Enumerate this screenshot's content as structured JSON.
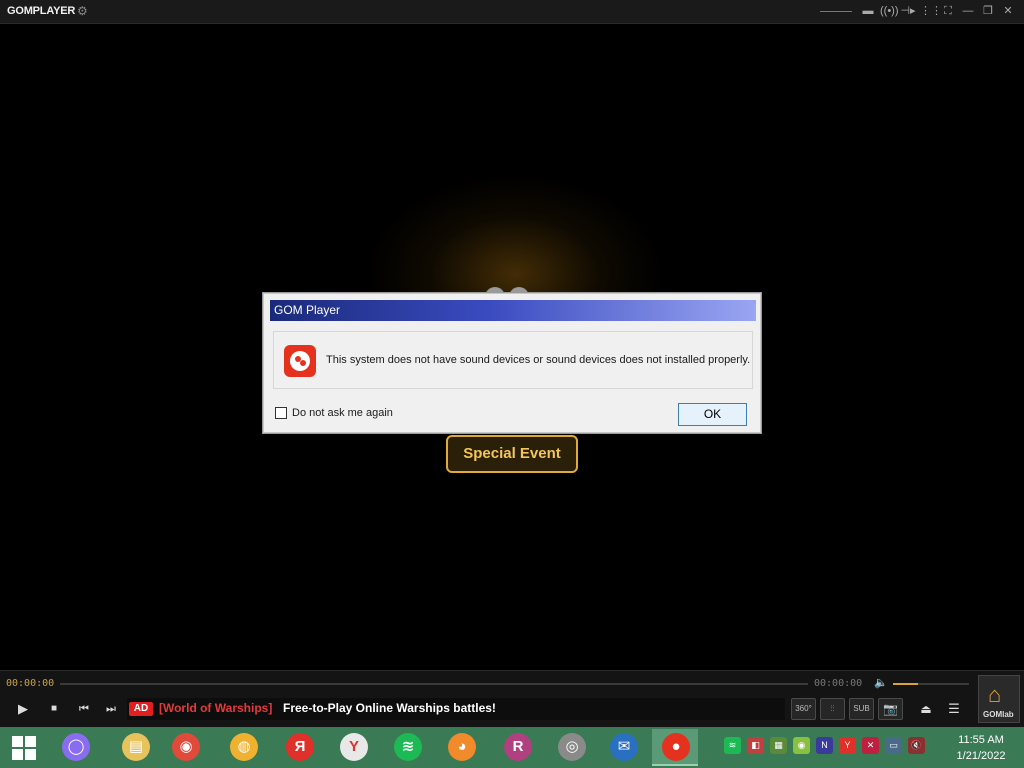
{
  "titlebar": {
    "app_name": "GOMPLAYER",
    "buttons": [
      "wireless-icon",
      "playlist-icon",
      "settings-icon",
      "fullscreen-icon",
      "minimize-icon",
      "maximize-icon",
      "close-icon"
    ]
  },
  "video": {
    "special_event_label": "Special Event"
  },
  "dialog": {
    "title": "GOM Player",
    "message": "This system does not have sound devices or sound devices does not installed properly.",
    "checkbox_label": "Do not ask me again",
    "checkbox_checked": false,
    "ok_label": "OK"
  },
  "controls": {
    "time_current": "00:00:00",
    "time_total": "00:00:00",
    "volume_level": 0.33,
    "ad": {
      "badge": "AD",
      "sponsor": "[World of Warships]",
      "text": "Free-to-Play Online Warships battles!"
    },
    "buttons": {
      "vr": "360°",
      "eq": "EQ",
      "sub": "SUB",
      "capture": "capture"
    },
    "home_label": "GOMlab"
  },
  "taskbar": {
    "apps": [
      {
        "name": "alice-icon",
        "color": "#8a6cf0",
        "glyph": "◯"
      },
      {
        "name": "file-explorer-icon",
        "color": "#e8c25a",
        "glyph": "▤"
      },
      {
        "name": "chrome-icon",
        "color": "#e04a3a",
        "glyph": "◉"
      },
      {
        "name": "security-icon",
        "color": "#f0b030",
        "glyph": "◍"
      },
      {
        "name": "yandex-icon",
        "color": "#e0302a",
        "glyph": "Я"
      },
      {
        "name": "yandex-browser-icon",
        "color": "#e8e8e8",
        "glyph": "Y"
      },
      {
        "name": "spotify-icon",
        "color": "#1db954",
        "glyph": "≋"
      },
      {
        "name": "firefox-icon",
        "color": "#f08a2a",
        "glyph": "◕"
      },
      {
        "name": "winrar-icon",
        "color": "#b04080",
        "glyph": "R"
      },
      {
        "name": "infra-recorder-icon",
        "color": "#8a8a8a",
        "glyph": "◎"
      },
      {
        "name": "thunderbird-icon",
        "color": "#2a70c0",
        "glyph": "✉"
      },
      {
        "name": "gom-player-icon",
        "color": "#e4321f",
        "glyph": "●"
      }
    ],
    "tray": [
      "spotify-tray-icon",
      "tray-icon-2",
      "tray-icon-3",
      "tray-icon-4",
      "tray-icon-5",
      "yandex-tray-icon",
      "tray-icon-7",
      "network-icon",
      "volume-muted-icon"
    ],
    "time": "11:55 AM",
    "date": "1/21/2022"
  }
}
